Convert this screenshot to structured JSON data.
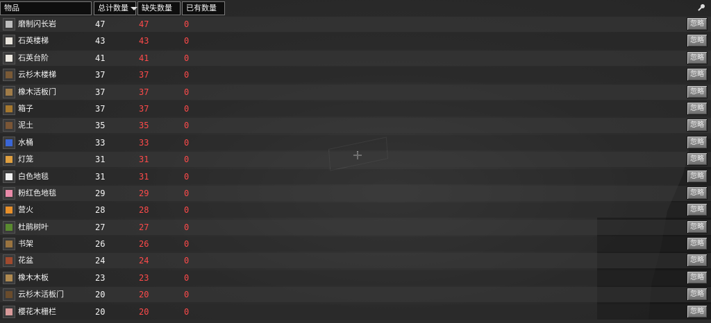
{
  "header": {
    "item_label": "物品",
    "total_label": "总计数量",
    "missing_label": "缺失数量",
    "have_label": "已有数量"
  },
  "rows": [
    {
      "name": "磨制闪长岩",
      "total": "47",
      "missing": "47",
      "have": "0",
      "ignore": "忽略",
      "icon": "polished-diorite-icon",
      "color": "#bdbdbd"
    },
    {
      "name": "石英楼梯",
      "total": "43",
      "missing": "43",
      "have": "0",
      "ignore": "忽略",
      "icon": "quartz-stairs-icon",
      "color": "#e8e4dc"
    },
    {
      "name": "石英台阶",
      "total": "41",
      "missing": "41",
      "have": "0",
      "ignore": "忽略",
      "icon": "quartz-slab-icon",
      "color": "#ece8e0"
    },
    {
      "name": "云杉木楼梯",
      "total": "37",
      "missing": "37",
      "have": "0",
      "ignore": "忽略",
      "icon": "spruce-stairs-icon",
      "color": "#7a5a36"
    },
    {
      "name": "橡木活板门",
      "total": "37",
      "missing": "37",
      "have": "0",
      "ignore": "忽略",
      "icon": "oak-trapdoor-icon",
      "color": "#a07c48"
    },
    {
      "name": "箱子",
      "total": "37",
      "missing": "37",
      "have": "0",
      "ignore": "忽略",
      "icon": "chest-icon",
      "color": "#a6782e"
    },
    {
      "name": "泥土",
      "total": "35",
      "missing": "35",
      "have": "0",
      "ignore": "忽略",
      "icon": "dirt-icon",
      "color": "#7a5636"
    },
    {
      "name": "水桶",
      "total": "33",
      "missing": "33",
      "have": "0",
      "ignore": "忽略",
      "icon": "water-bucket-icon",
      "color": "#3a66d6"
    },
    {
      "name": "灯笼",
      "total": "31",
      "missing": "31",
      "have": "0",
      "ignore": "忽略",
      "icon": "lantern-icon",
      "color": "#e0a040"
    },
    {
      "name": "白色地毯",
      "total": "31",
      "missing": "31",
      "have": "0",
      "ignore": "忽略",
      "icon": "white-carpet-icon",
      "color": "#f0f0f0"
    },
    {
      "name": "粉红色地毯",
      "total": "29",
      "missing": "29",
      "have": "0",
      "ignore": "忽略",
      "icon": "pink-carpet-icon",
      "color": "#e88aa8"
    },
    {
      "name": "营火",
      "total": "28",
      "missing": "28",
      "have": "0",
      "ignore": "忽略",
      "icon": "campfire-icon",
      "color": "#e8902a"
    },
    {
      "name": "杜鹃树叶",
      "total": "27",
      "missing": "27",
      "have": "0",
      "ignore": "忽略",
      "icon": "azalea-leaves-icon",
      "color": "#5a8a30"
    },
    {
      "name": "书架",
      "total": "26",
      "missing": "26",
      "have": "0",
      "ignore": "忽略",
      "icon": "bookshelf-icon",
      "color": "#9a7440"
    },
    {
      "name": "花盆",
      "total": "24",
      "missing": "24",
      "have": "0",
      "ignore": "忽略",
      "icon": "flower-pot-icon",
      "color": "#a04a2e"
    },
    {
      "name": "橡木木板",
      "total": "23",
      "missing": "23",
      "have": "0",
      "ignore": "忽略",
      "icon": "oak-planks-icon",
      "color": "#b08a50"
    },
    {
      "name": "云杉木活板门",
      "total": "20",
      "missing": "20",
      "have": "0",
      "ignore": "忽略",
      "icon": "spruce-trapdoor-icon",
      "color": "#6a4c2c"
    },
    {
      "name": "樱花木栅栏",
      "total": "20",
      "missing": "20",
      "have": "0",
      "ignore": "忽略",
      "icon": "cherry-fence-icon",
      "color": "#d89a9a"
    }
  ]
}
